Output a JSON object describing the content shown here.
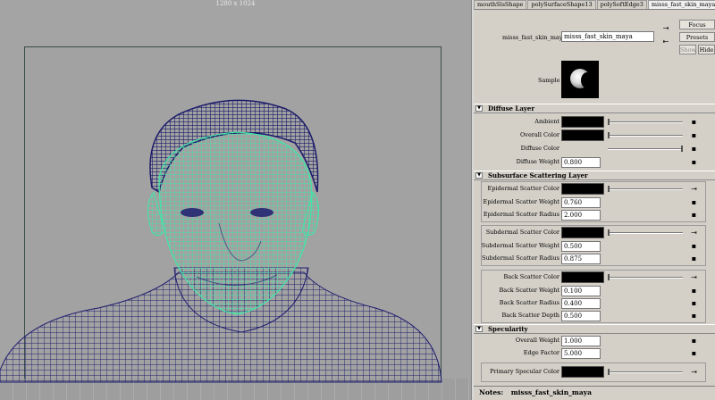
{
  "viewport": {
    "resolution_label": "1280 x 1024"
  },
  "tabs": [
    {
      "label": "mouthSlsShape",
      "active": false
    },
    {
      "label": "polySurfaceShape13",
      "active": false
    },
    {
      "label": "polySoftEdge3",
      "active": false
    },
    {
      "label": "misss_fast_skin_maya",
      "active": true
    },
    {
      "label": "misss_f",
      "active": false
    }
  ],
  "header": {
    "node_label": "misss_fast_skin_maya:",
    "node_value": "misss_fast_skin_maya",
    "focus_label": "Focus",
    "presets_label": "Presets",
    "show_label": "Show",
    "hide_label": "Hide",
    "sample_label": "Sample"
  },
  "sections": {
    "diffuse": "Diffuse Layer",
    "subsurface": "Subsurface Scattering Layer",
    "specularity": "Specularity"
  },
  "diffuse": {
    "ambient": {
      "label": "Ambient"
    },
    "overall_color": {
      "label": "Overall Color"
    },
    "diffuse_color": {
      "label": "Diffuse Color"
    },
    "diffuse_weight": {
      "label": "Diffuse Weight",
      "value": "0.800"
    }
  },
  "subsurface": {
    "epi_color": {
      "label": "Epidermal Scatter Color"
    },
    "epi_weight": {
      "label": "Epidermal Scatter Weight",
      "value": "0.760"
    },
    "epi_radius": {
      "label": "Epidermal Scatter Radius",
      "value": "2.000"
    },
    "sub_color": {
      "label": "Subdermal Scatter Color"
    },
    "sub_weight": {
      "label": "Subdermal Scatter Weight",
      "value": "0.500"
    },
    "sub_radius": {
      "label": "Subdermal Scatter Radius",
      "value": "0.875"
    },
    "back_color": {
      "label": "Back Scatter Color"
    },
    "back_weight": {
      "label": "Back Scatter Weight",
      "value": "0.100"
    },
    "back_radius": {
      "label": "Back Scatter Radius",
      "value": "0.400"
    },
    "back_depth": {
      "label": "Back Scatter Depth",
      "value": "0.500"
    }
  },
  "specularity": {
    "overall_weight": {
      "label": "Overall Weight",
      "value": "1.000"
    },
    "edge_factor": {
      "label": "Edge Factor",
      "value": "5.000"
    },
    "primary_color": {
      "label": "Primary Specular Color"
    }
  },
  "notes": {
    "label": "Notes:",
    "value": "misss_fast_skin_maya"
  },
  "colors": {
    "wire_front": "#4ef2b0",
    "wire_back": "#1e1c6e",
    "panel_bg": "#d4d0c8"
  }
}
